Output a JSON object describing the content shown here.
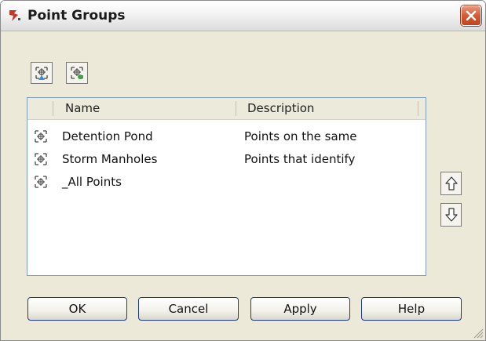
{
  "window": {
    "title": "Point Groups"
  },
  "list": {
    "columns": {
      "name": "Name",
      "description": "Description"
    },
    "rows": [
      {
        "name": "Detention Pond",
        "description": "Points on the same"
      },
      {
        "name": "Storm Manholes",
        "description": "Points that identify"
      },
      {
        "name": "_All Points",
        "description": ""
      }
    ]
  },
  "buttons": {
    "ok": "OK",
    "cancel": "Cancel",
    "apply": "Apply",
    "help": "Help"
  },
  "icons": {
    "app": "civil3d-app-icon",
    "toolbar": [
      "point-group-properties-icon",
      "update-point-groups-icon"
    ],
    "row": "point-group-icon",
    "move_up": "arrow-up-icon",
    "move_down": "arrow-down-icon",
    "close": "close-icon"
  },
  "colors": {
    "close_button": "#d45a36",
    "list_border": "#7f9db9",
    "button_border": "#1f3c88"
  }
}
